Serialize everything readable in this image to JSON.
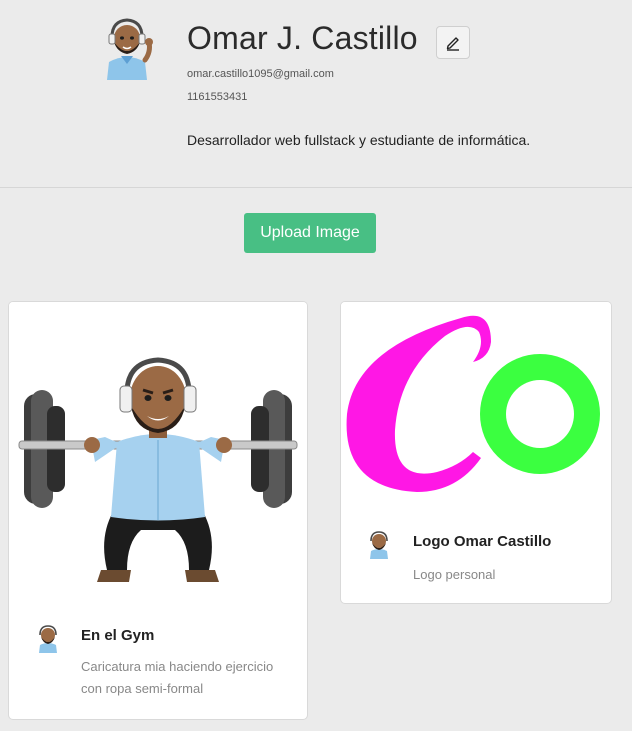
{
  "profile": {
    "name": "Omar J. Castillo",
    "email": "omar.castillo1095@gmail.com",
    "phone": "1161553431",
    "bio": "Desarrollador web fullstack y estudiante de informática."
  },
  "actions": {
    "upload_label": "Upload Image"
  },
  "cards": [
    {
      "title": "En el Gym",
      "description": "Caricatura mia haciendo ejercicio con ropa semi-formal",
      "image_icon": "weightlifting-avatar-image"
    },
    {
      "title": "Logo Omar Castillo",
      "description": "Logo personal",
      "image_icon": "co-logo-image"
    }
  ],
  "colors": {
    "upload_button": "#48bf84",
    "logo_magenta": "#ff17e5",
    "logo_green": "#3bff40"
  }
}
